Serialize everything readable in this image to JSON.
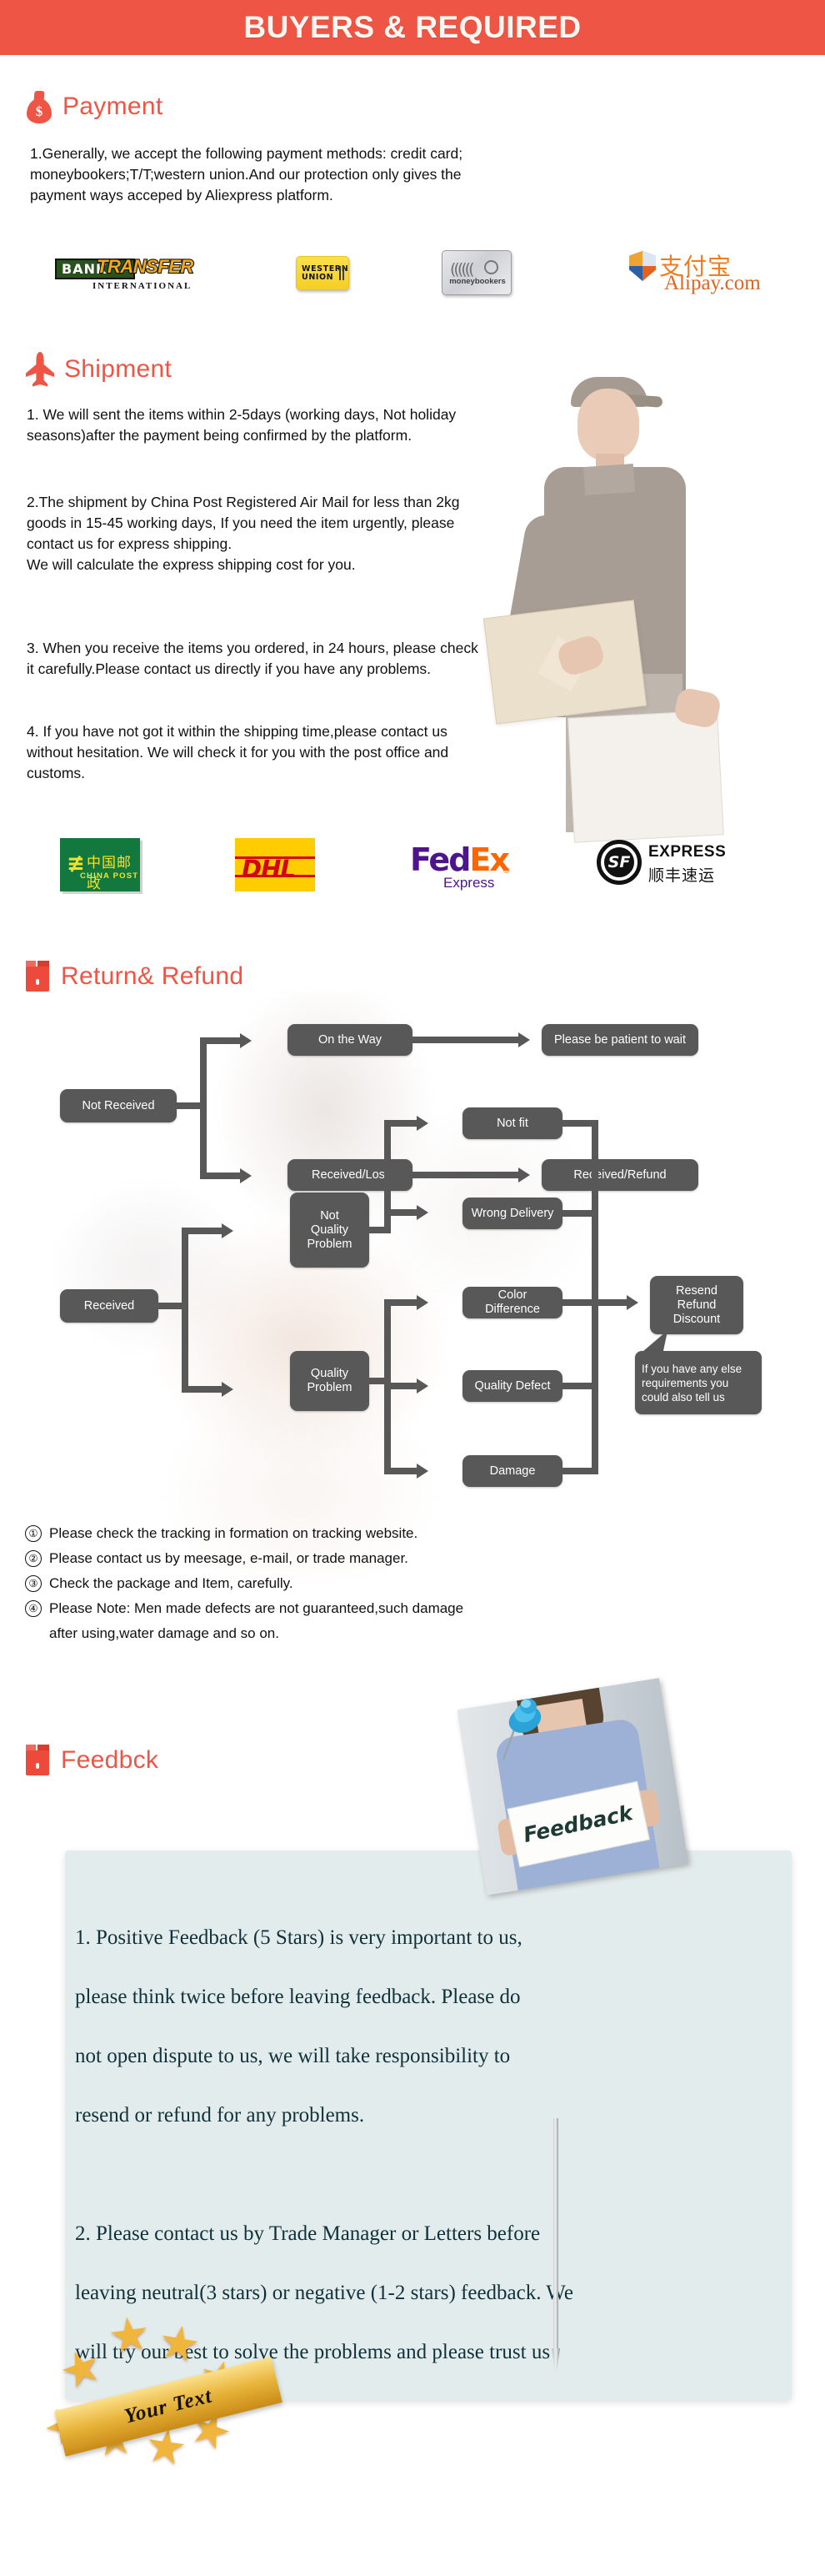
{
  "banner": {
    "title": "BUYERS & REQUIRED"
  },
  "payment": {
    "heading": "Payment",
    "icon": "money-bag-icon",
    "body": "1.Generally, we accept the following payment methods: credit card;\nmoneybookers;T/T;western union.And our protection only gives the\npayment ways acceped by Aliexpress platform.",
    "logos": [
      {
        "name": "bank-transfer-logo",
        "primary": "BANK",
        "secondary": "TRANSFER",
        "tertiary": "INTERNATIONAL"
      },
      {
        "name": "western-union-logo",
        "line1": "WESTERN",
        "line2": "UNION"
      },
      {
        "name": "moneybookers-logo",
        "label": "moneybookers"
      },
      {
        "name": "alipay-logo",
        "cn": "支付宝",
        "label": "Alipay.com"
      }
    ]
  },
  "shipment": {
    "heading": "Shipment",
    "icon": "airplane-icon",
    "paragraphs": [
      "1. We will sent the items within 2-5days (working days, Not holiday\nseasons)after the payment being confirmed by the platform.",
      "2.The shipment by China Post Registered Air Mail for less than  2kg\ngoods in 15-45 working days, If  you need the item urgently, please\ncontact us for express shipping.\nWe will calculate the express shipping cost for you.",
      "3. When you receive the items you ordered, in 24 hours, please check\n it carefully.Please contact us directly if you have any problems.",
      "4. If you have not got it within the shipping time,please contact us\nwithout hesitation. We will check it for you with the post office and\ncustoms."
    ],
    "carriers": [
      {
        "name": "china-post-logo",
        "cn": "中国邮政",
        "en": "CHINA POST"
      },
      {
        "name": "dhl-logo",
        "label": "DHL"
      },
      {
        "name": "fedex-logo",
        "fed": "Fed",
        "ex": "Ex",
        "sub": "Express",
        "mark": "®"
      },
      {
        "name": "sf-express-logo",
        "mark": "SF",
        "en": "EXPRESS",
        "cn": "顺丰速运"
      }
    ]
  },
  "return_refund": {
    "heading": "Return& Refund",
    "icon": "package-box-icon",
    "flow": {
      "not_received": "Not Received",
      "on_the_way": "On the Way",
      "please_wait": "Please be patient to wait",
      "received_lost": "Received/Lost",
      "received_refund": "Received/Refund",
      "received": "Received",
      "not_quality_problem": "Not\nQuality\nProblem",
      "quality_problem": "Quality\nProblem",
      "not_fit": "Not fit",
      "wrong_delivery": "Wrong Delivery",
      "color_difference": "Color Difference",
      "quality_defect": "Quality Defect",
      "damage": "Damage",
      "resend_refund_discount": "Resend\nRefund\nDiscount",
      "callout": "If you have any else\nrequirements you\ncould also tell us"
    },
    "notes": [
      {
        "num": "①",
        "text": "Please check the tracking in formation on tracking website."
      },
      {
        "num": "②",
        "text": "Please contact us by meesage, e-mail, or trade manager."
      },
      {
        "num": "③",
        "text": "Check the package and Item, carefully."
      },
      {
        "num": "④",
        "text": "Please Note: Men made defects  are not guaranteed,such damage\n     after using,water damage and so on."
      }
    ]
  },
  "feedback": {
    "heading": "Feedbck",
    "icon": "package-box-icon",
    "photo_card_label": "Feedback",
    "body": "1. Positive Feedback (5 Stars) is very important to us,\nplease think twice before leaving feedback. Please do\nnot open dispute to us,   we will take responsibility to\nresend or refund for any problems.\n\n2. Please contact us by Trade Manager or Letters before\nleaving neutral(3 stars) or negative (1-2 stars) feedback. We\nwill try our best to solve the problems and please trust us",
    "badge_text": "Your Text"
  },
  "colors": {
    "banner_bg": "#ef5545",
    "heading": "#ef5545",
    "flow_node": "#585858",
    "feedback_panel": "#e3ecec",
    "body_text": "#111111"
  }
}
